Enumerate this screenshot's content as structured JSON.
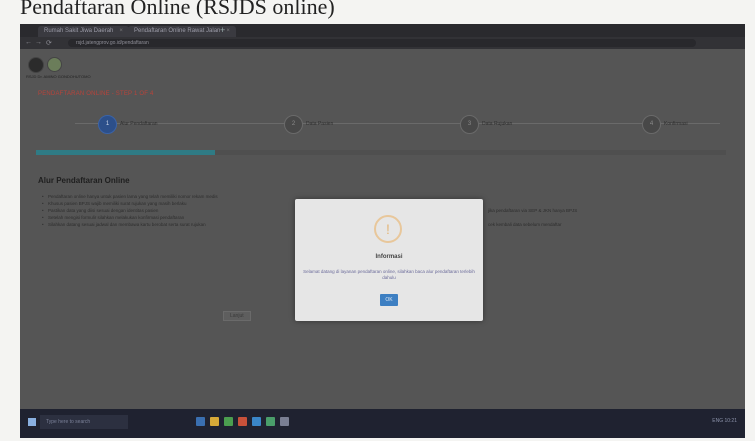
{
  "caption": "Pendaftaran Online (RSJDS online)",
  "browser": {
    "tabs": [
      {
        "label": "Rumah Sakit Jiwa Daerah"
      },
      {
        "label": "Pendaftaran Online Rawat Jalan"
      }
    ],
    "url": "rsjd.jatengprov.go.id/pendaftaran"
  },
  "page": {
    "logo_text": "RSJD Dr. AMINO GONDOHUTOMO",
    "step_title": "PENDAFTARAN ONLINE - STEP 1 OF 4",
    "steps": [
      {
        "number": "1",
        "label": "Alur Pendaftaran"
      },
      {
        "number": "2",
        "label": "Data Pasien"
      },
      {
        "number": "3",
        "label": "Data Rujukan"
      },
      {
        "number": "4",
        "label": "Konfirmasi"
      }
    ],
    "progress_percent": 26,
    "section_title": "Alur Pendaftaran Online",
    "bullets": [
      "Pendaftaran online hanya untuk pasien lama yang telah memiliki nomor rekam medis",
      "Khusus pasien BPJS wajib memiliki surat rujukan yang masih berlaku",
      "Pastikan data yang diisi sesuai dengan identitas pasien",
      "Setelah mengisi formulir silahkan melakukan konfirmasi pendaftaran",
      "Silahkan datang sesuai jadwal dan membawa kartu berobat serta surat rujukan"
    ],
    "bullet_right": "jika pendaftaran via SEP & JKN hanya BPJS",
    "bullet_right2": "cek kembali data sebelum mendaftar",
    "next_button": "Lanjut"
  },
  "modal": {
    "icon": "!",
    "title": "Informasi",
    "message": "Selamat datang di layanan pendaftaran online, silahkan baca alur pendaftaran terlebih dahulu",
    "ok_label": "OK"
  },
  "taskbar": {
    "search_placeholder": "Type here to search",
    "tray_text": "ENG 10:21"
  }
}
